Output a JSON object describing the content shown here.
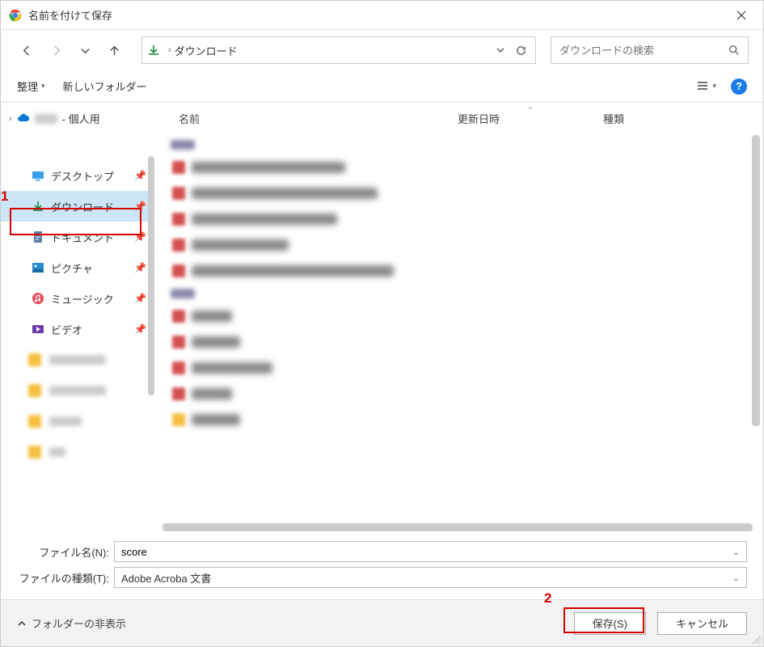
{
  "titlebar": {
    "title": "名前を付けて保存"
  },
  "nav": {
    "address_crumb": "ダウンロード",
    "search_placeholder": "ダウンロードの検索"
  },
  "toolbar": {
    "organize": "整理",
    "new_folder": "新しいフォルダー"
  },
  "sidebar": {
    "top_label": "- 個人用",
    "items": [
      {
        "label": "デスクトップ"
      },
      {
        "label": "ダウンロード"
      },
      {
        "label": "ドキュメント"
      },
      {
        "label": "ピクチャ"
      },
      {
        "label": "ミュージック"
      },
      {
        "label": "ビデオ"
      }
    ]
  },
  "columns": {
    "name": "名前",
    "date": "更新日時",
    "type": "種類"
  },
  "form": {
    "filename_label": "ファイル名(N):",
    "filename_value": "score",
    "filetype_label": "ファイルの種類(T):",
    "filetype_value": "Adobe Acroba 文書"
  },
  "footer": {
    "hide_folders": "フォルダーの非表示",
    "save": "保存(S)",
    "cancel": "キャンセル"
  },
  "annotations": {
    "num1": "1",
    "num2": "2"
  }
}
